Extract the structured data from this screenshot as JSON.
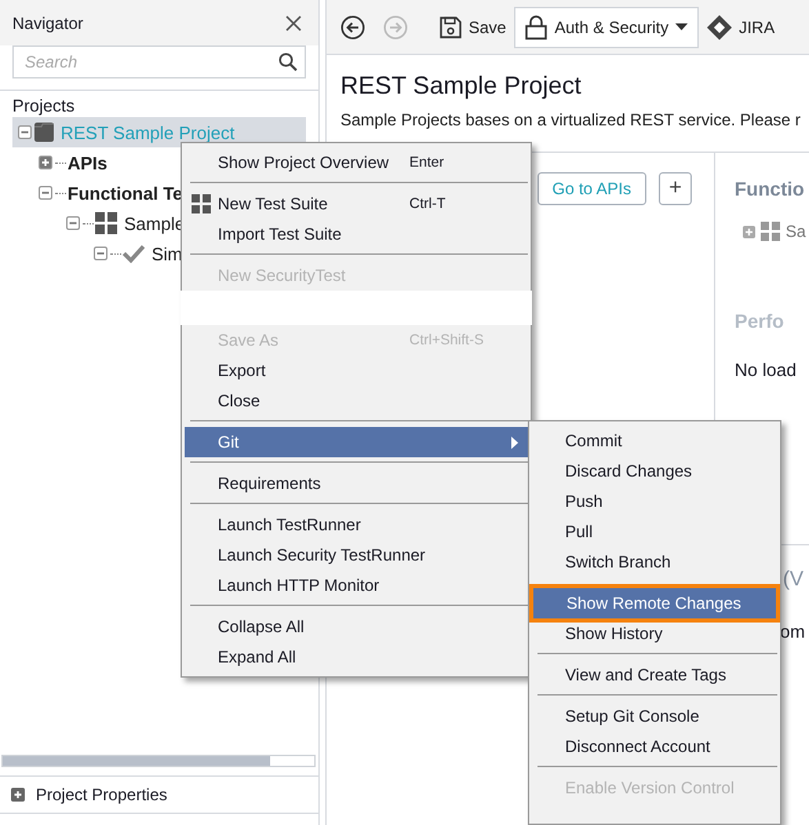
{
  "navigator": {
    "title": "Navigator",
    "search": {
      "placeholder": "Search"
    },
    "section_label": "Projects",
    "tree": [
      {
        "label": "REST Sample Project",
        "kind": "project",
        "selected": true,
        "expanded": true,
        "children": [
          {
            "label": "APIs",
            "kind": "folder",
            "selected": false,
            "expanded": false
          },
          {
            "label": "Functional Te",
            "kind": "folder",
            "selected": false,
            "expanded": true,
            "children": [
              {
                "label": "Sample",
                "kind": "suite",
                "selected": false,
                "expanded": true,
                "children": [
                  {
                    "label": "Sim",
                    "kind": "testcase",
                    "selected": false,
                    "expanded": true
                  }
                ]
              }
            ]
          }
        ]
      }
    ],
    "footer": {
      "label": "Project Properties"
    }
  },
  "toolbar": {
    "buttons": [
      {
        "kind": "back",
        "disabled": false
      },
      {
        "kind": "forward",
        "disabled": true
      },
      {
        "kind": "save",
        "label": "Save",
        "disabled": false
      },
      {
        "kind": "dropdown",
        "label": "Auth & Security",
        "disabled": false
      },
      {
        "kind": "jira",
        "label": "JIRA",
        "disabled": false
      }
    ]
  },
  "project": {
    "title": "REST Sample Project",
    "description": "Sample Projects bases on a virtualized REST service. Please r",
    "actions": [
      {
        "kind": "text",
        "label": "Go to APIs"
      },
      {
        "kind": "add",
        "label": "+"
      }
    ],
    "side_panel": [
      {
        "heading": "Functio",
        "rows": [
          "Sa"
        ]
      },
      {
        "heading": "Perfo",
        "text": "No load"
      },
      {
        "heading": "(V",
        "text": "om"
      }
    ]
  },
  "context_menu": {
    "items": [
      {
        "kind": "item",
        "label": "Show Project Overview",
        "shortcut": "Enter",
        "disabled": false,
        "selected": false
      },
      {
        "kind": "separator"
      },
      {
        "kind": "grid_item",
        "label": "New Test Suite",
        "shortcut": "Ctrl-T",
        "disabled": false,
        "selected": false
      },
      {
        "kind": "item",
        "label": "Import Test Suite",
        "disabled": false,
        "selected": false
      },
      {
        "kind": "separator"
      },
      {
        "kind": "item",
        "label": "New SecurityTest",
        "disabled": true,
        "selected": false
      },
      {
        "kind": "gap"
      },
      {
        "kind": "item",
        "label": "Save As",
        "shortcut": "Ctrl+Shift-S",
        "disabled": true,
        "selected": false
      },
      {
        "kind": "item",
        "label": "Export",
        "disabled": false,
        "selected": false
      },
      {
        "kind": "item",
        "label": "Close",
        "disabled": false,
        "selected": false
      },
      {
        "kind": "separator"
      },
      {
        "kind": "item",
        "label": "Git",
        "submenu": true,
        "disabled": false,
        "selected": true
      },
      {
        "kind": "separator"
      },
      {
        "kind": "item",
        "label": "Requirements",
        "disabled": false,
        "selected": false
      },
      {
        "kind": "separator"
      },
      {
        "kind": "item",
        "label": "Launch TestRunner",
        "disabled": false,
        "selected": false
      },
      {
        "kind": "item",
        "label": "Launch Security TestRunner",
        "disabled": false,
        "selected": false
      },
      {
        "kind": "item",
        "label": "Launch HTTP Monitor",
        "disabled": false,
        "selected": false
      },
      {
        "kind": "separator"
      },
      {
        "kind": "item",
        "label": "Collapse All",
        "disabled": false,
        "selected": false
      },
      {
        "kind": "item",
        "label": "Expand All",
        "disabled": false,
        "selected": false
      }
    ]
  },
  "submenu": {
    "items": [
      {
        "kind": "item",
        "label": "Commit",
        "disabled": false,
        "selected": false
      },
      {
        "kind": "item",
        "label": "Discard Changes",
        "disabled": false,
        "selected": false
      },
      {
        "kind": "item",
        "label": "Push",
        "disabled": false,
        "selected": false
      },
      {
        "kind": "item",
        "label": "Pull",
        "disabled": false,
        "selected": false
      },
      {
        "kind": "item",
        "label": "Switch Branch",
        "disabled": false,
        "selected": false
      },
      {
        "kind": "item",
        "label": "Show Remote Changes",
        "disabled": false,
        "selected": true
      },
      {
        "kind": "item",
        "label": "Show History",
        "disabled": false,
        "selected": false
      },
      {
        "kind": "separator"
      },
      {
        "kind": "item",
        "label": "View and Create Tags",
        "disabled": false,
        "selected": false
      },
      {
        "kind": "separator"
      },
      {
        "kind": "item",
        "label": "Setup Git Console",
        "disabled": false,
        "selected": false
      },
      {
        "kind": "item",
        "label": "Disconnect Account",
        "disabled": false,
        "selected": false
      },
      {
        "kind": "separator"
      },
      {
        "kind": "item",
        "label": "Enable Version Control",
        "disabled": true,
        "selected": false
      }
    ]
  }
}
